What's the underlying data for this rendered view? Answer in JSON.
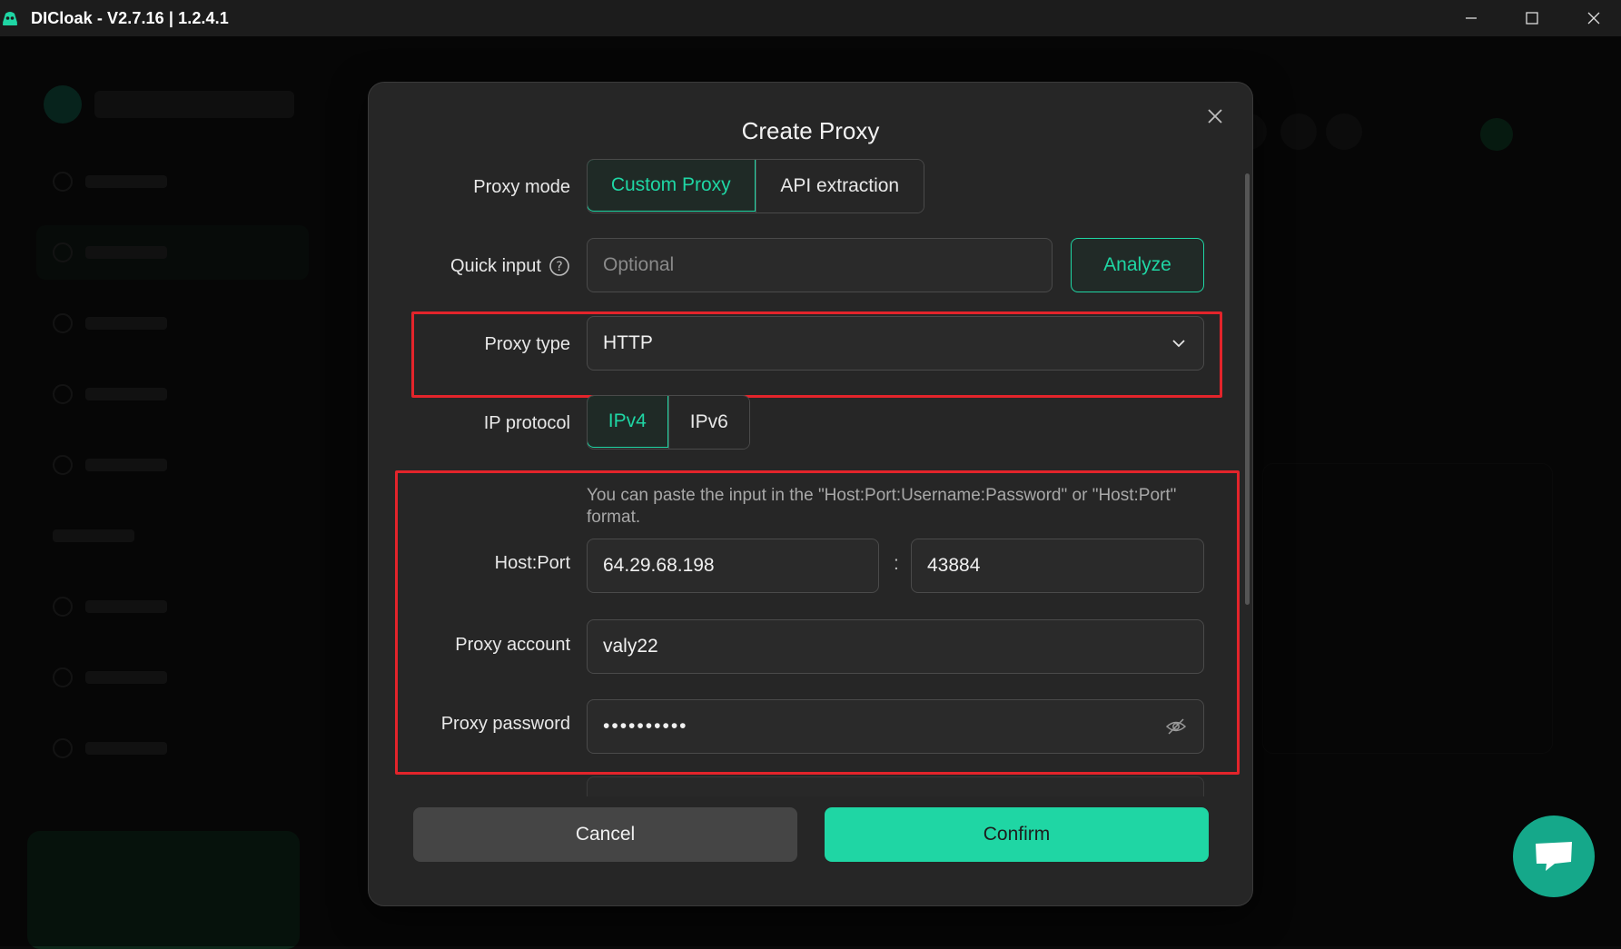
{
  "window": {
    "title": "DICloak - V2.7.16 | 1.2.4.1"
  },
  "dialog": {
    "title": "Create Proxy",
    "proxy_mode": {
      "label": "Proxy mode",
      "options": [
        "Custom Proxy",
        "API extraction"
      ],
      "selected": "Custom Proxy"
    },
    "quick_input": {
      "label": "Quick input",
      "placeholder": "Optional",
      "analyze_label": "Analyze"
    },
    "proxy_type": {
      "label": "Proxy type",
      "value": "HTTP"
    },
    "ip_protocol": {
      "label": "IP protocol",
      "options": [
        "IPv4",
        "IPv6"
      ],
      "selected": "IPv4"
    },
    "host_port": {
      "hint": "You can paste the input in the \"Host:Port:Username:Password\" or \"Host:Port\" format.",
      "label": "Host:Port",
      "host": "64.29.68.198",
      "separator": ":",
      "port": "43884"
    },
    "proxy_account": {
      "label": "Proxy account",
      "value": "valy22"
    },
    "proxy_password": {
      "label": "Proxy password",
      "value": "••••••••••"
    },
    "footer": {
      "cancel_label": "Cancel",
      "confirm_label": "Confirm"
    }
  },
  "colors": {
    "accent": "#1fd6a4",
    "highlight_border": "#e3242b",
    "modal_bg": "#262626"
  },
  "icons": {
    "app": "dicloak-logo-icon",
    "help": "question-circle-icon",
    "dropdown": "chevron-down-icon",
    "password_toggle": "eye-off-icon",
    "close": "close-icon",
    "chat": "chat-bubble-icon"
  }
}
